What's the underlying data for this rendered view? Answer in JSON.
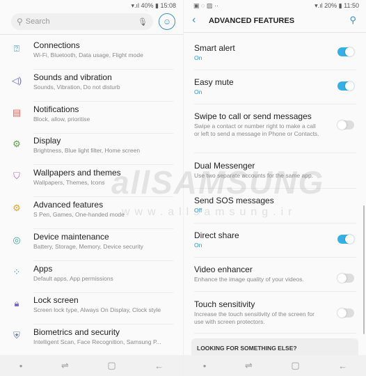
{
  "left": {
    "status": {
      "battery": "40%",
      "time": "15:08"
    },
    "search": {
      "placeholder": "Search"
    },
    "items": [
      {
        "title": "Connections",
        "subtitle": "Wi-Fi, Bluetooth, Data usage, Flight mode",
        "icon": "connections-icon",
        "glyph": "⍰",
        "color": "#3a8fc4"
      },
      {
        "title": "Sounds and vibration",
        "subtitle": "Sounds, Vibration, Do not disturb",
        "icon": "speaker-icon",
        "glyph": "◁)",
        "color": "#6b6bd6"
      },
      {
        "title": "Notifications",
        "subtitle": "Block, allow, prioritise",
        "icon": "notifications-icon",
        "glyph": "▤",
        "color": "#e0665a"
      },
      {
        "title": "Display",
        "subtitle": "Brightness, Blue light filter, Home screen",
        "icon": "display-icon",
        "glyph": "⚙",
        "color": "#5aa04a"
      },
      {
        "title": "Wallpapers and themes",
        "subtitle": "Wallpapers, Themes, Icons",
        "icon": "brush-icon",
        "glyph": "⛉",
        "color": "#b066c6"
      },
      {
        "title": "Advanced features",
        "subtitle": "S Pen, Games, One-handed mode",
        "icon": "advanced-gear-icon",
        "glyph": "⚙",
        "color": "#e0a52a"
      },
      {
        "title": "Device maintenance",
        "subtitle": "Battery, Storage, Memory, Device security",
        "icon": "maintenance-icon",
        "glyph": "◎",
        "color": "#3aa79a"
      },
      {
        "title": "Apps",
        "subtitle": "Default apps, App permissions",
        "icon": "apps-icon",
        "glyph": "⁘",
        "color": "#3a8fc4"
      },
      {
        "title": "Lock screen",
        "subtitle": "Screen lock type, Always On Display, Clock style",
        "icon": "lock-icon",
        "glyph": "🔒︎",
        "color": "#7b66c6"
      },
      {
        "title": "Biometrics and security",
        "subtitle": "Intelligent Scan, Face Recognition, Samsung P...",
        "icon": "shield-icon",
        "glyph": "⛨",
        "color": "#6a7fa8"
      }
    ]
  },
  "right": {
    "status": {
      "battery": "20%",
      "time": "11:50"
    },
    "title": "ADVANCED FEATURES",
    "items": [
      {
        "title": "Smart alert",
        "subtitle": "On",
        "state": "on",
        "toggle": true
      },
      {
        "title": "Easy mute",
        "subtitle": "On",
        "state": "on",
        "toggle": true
      },
      {
        "title": "Swipe to call or send messages",
        "subtitle": "Swipe a contact or number right to make a call or left to send a message in Phone or Contacts.",
        "state": "off",
        "toggle": true
      },
      {
        "title": "Dual Messenger",
        "subtitle": "Use two separate accounts for the same app.",
        "toggle": false
      },
      {
        "title": "Send SOS messages",
        "subtitle": "Off",
        "state": "status",
        "toggle": false
      },
      {
        "title": "Direct share",
        "subtitle": "On",
        "state": "on",
        "toggle": true
      },
      {
        "title": "Video enhancer",
        "subtitle": "Enhance the image quality of your videos.",
        "state": "off",
        "toggle": true
      },
      {
        "title": "Touch sensitivity",
        "subtitle": "Increase the touch sensitivity of the screen for use with screen protectors.",
        "state": "off",
        "toggle": true
      }
    ],
    "looking": "LOOKING FOR SOMETHING ELSE?"
  },
  "watermark": {
    "logo": "allSAMSUNG",
    "url": "www.allsamsung.ir"
  },
  "colors": {
    "accent": "#35b0e6"
  }
}
